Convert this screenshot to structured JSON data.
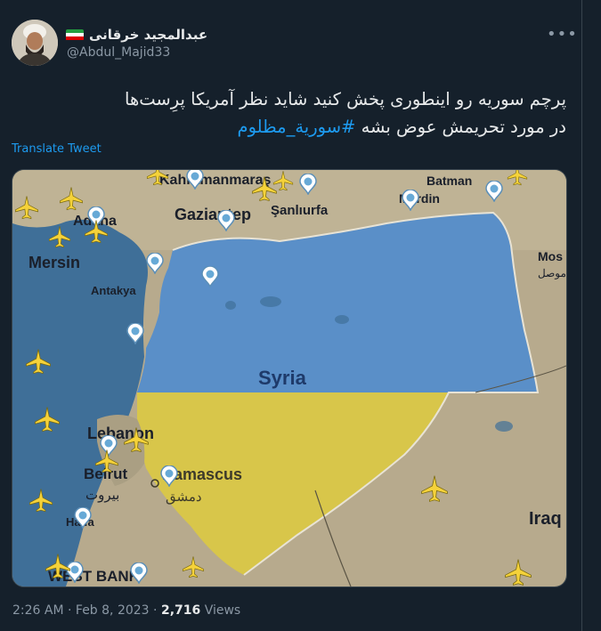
{
  "author": {
    "name": "عبدالمجید خرقانی",
    "handle": "@Abdul_Majid33",
    "flag": "iran-flag"
  },
  "more_icon": "more-icon",
  "tweet": {
    "line1": "پرچم سوریه رو اینطوری پخش کنید شاید نظر آمریکا پرِست‌ها",
    "line2_prefix": "در مورد تحریمش عوض بشه",
    "hashtag": "#سورية_مظلوم"
  },
  "translate_label": "Translate Tweet",
  "map": {
    "labels": {
      "kahramanmaras": "Kahramanmaraş",
      "gaziantep": "Gaziantep",
      "sanliurfa": "Şanlıurfa",
      "batman": "Batman",
      "mardin": "Mardin",
      "adana": "Adana",
      "mersin": "Mersin",
      "antakya": "Antakya",
      "mosul": "Mos",
      "mosul_ar": "موصل",
      "syria": "Syria",
      "lebanon": "Lebanon",
      "beirut": "Beirut",
      "beirut_ar": "بيروت",
      "damascus": "Damascus",
      "damascus_ar": "دمشق",
      "haifa": "Haifa",
      "west_bank": "WEST BANK",
      "iraq": "Iraq"
    },
    "colors": {
      "flag_blue": "#5a8fc8",
      "flag_yellow": "#d8c64a",
      "sea": "#3f6f98",
      "land": "#b7aa8d",
      "plane": "#f5d23a",
      "pin": "#67a9d6"
    }
  },
  "meta": {
    "time": "2:26 AM",
    "date": "Feb 8, 2023",
    "views_count": "2,716",
    "views_label": "Views",
    "dot": "·"
  }
}
